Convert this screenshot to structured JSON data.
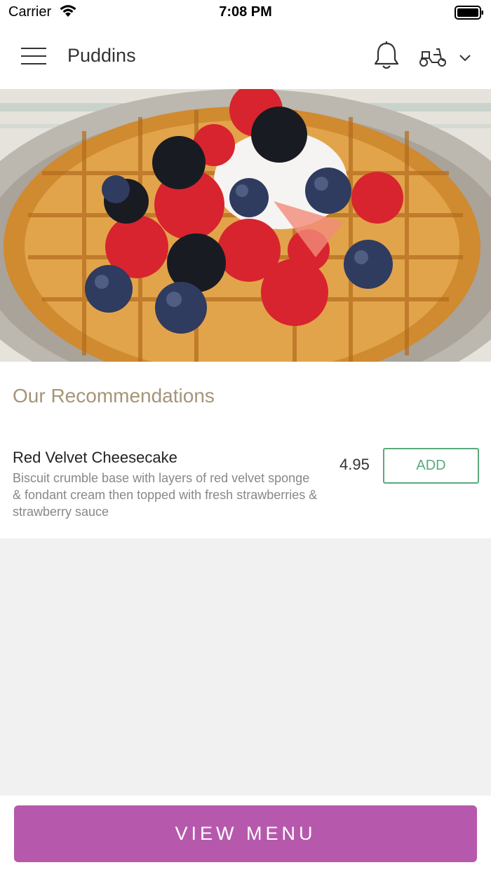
{
  "status_bar": {
    "carrier": "Carrier",
    "time": "7:08 PM"
  },
  "header": {
    "title": "Puddins",
    "icons": [
      "menu-icon",
      "bell-icon",
      "scooter-icon",
      "chevron-down-icon"
    ]
  },
  "hero": {
    "image": "waffle-with-berries"
  },
  "recommendations": {
    "title": "Our Recommendations",
    "items": [
      {
        "name": "Red Velvet Cheesecake",
        "description": "Biscuit crumble base with layers of red velvet sponge & fondant cream then topped with fresh strawberries & strawberry sauce",
        "price": "4.95",
        "add_label": "ADD"
      }
    ]
  },
  "footer": {
    "view_menu_label": "VIEW MENU"
  },
  "colors": {
    "accent": "#b659ad",
    "add_green": "#5aa97a",
    "section_title": "#a59577",
    "background": "#f1f1f1"
  }
}
